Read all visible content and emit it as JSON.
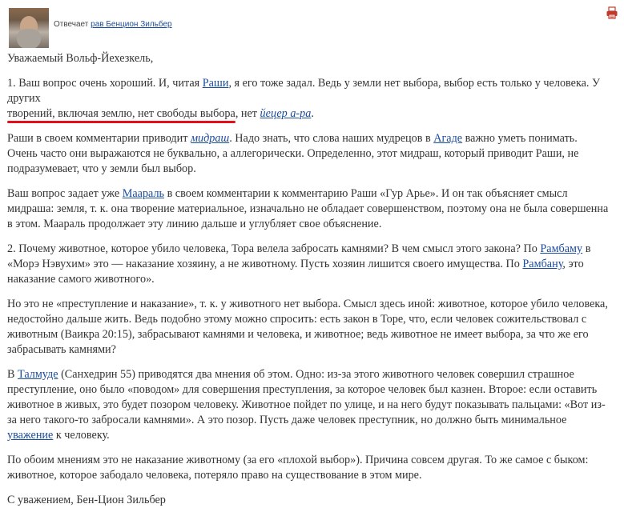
{
  "header": {
    "answered_by_prefix": "Отвечает",
    "author_name": "рав Бенцион Зильбер",
    "print_icon": "printer-icon"
  },
  "greeting": "Уважаемый Вольф-Йехезкель,",
  "p1": {
    "a": "1. Ваш вопрос очень хороший. И, читая ",
    "rashi": "Раши",
    "b": ", я его тоже задал. Ведь ",
    "hl1": "у земли нет выбора, выбор есть только у человека. У других",
    "hl2": "творений, включая землю, нет свободы выбора",
    "c": ", нет ",
    "yetzer": "йецер а-ра",
    "d": "."
  },
  "p2": {
    "a": "Раши в своем комментарии приводит ",
    "midrash": "мидраш",
    "b": ". Надо знать, что слова наших мудрецов в ",
    "agada": "Агаде",
    "c": " важно уметь понимать. Очень часто они выражаются не буквально, а аллегорически. Определенно, этот мидраш, который приводит Раши, не подразумевает, что у земли был выбор."
  },
  "p3": {
    "a": "Ваш вопрос задает уже ",
    "maharal": "Маараль",
    "b": " в своем комментарии к комментарию Раши «Гур Арье». И он так объясняет смысл мидраша: земля, т. к. она творение материальное, изначально не обладает совершенством, поэтому она не была совершенна в этом. Маараль продолжает эту линию дальше и углубляет свое объяснение."
  },
  "p4": {
    "a": "2. Почему животное, которое убило человека, Тора велела забросать камнями? В чем смысл этого закона? По ",
    "rambam": "Рамбаму",
    "b": " в «Морэ Нэвухим» это — наказание хозяину, а не животному. Пусть хозяин лишится своего имущества. По ",
    "ramban": "Рамбану",
    "c": ", это наказание самого животного»."
  },
  "p5": "Но это не «преступление и наказание», т. к. у животного нет выбора. Смысл здесь иной: животное, которое убило человека, недостойно дальше жить. Ведь подобно этому можно спросить: есть закон в Торе, что, если человек сожительствовал с животным (Ваикра 20:15), забрасывают камнями и человека, и животное; ведь животное не имеет выбора, за что же его забрасывать камнями?",
  "p6": {
    "a": "В ",
    "talmud": "Талмуде",
    "b": " (Санхедрин 55) приводятся два мнения об этом. Одно: из-за этого животного человек совершил страшное преступление, оно было «поводом» для совершения преступления, за которое человек был казнен. Второе: если оставить животное в живых, это будет позором человеку. Животное пойдет по улице, и на него будут показывать пальцами: «Вот из-за него такого-то забросали камнями». А это позор. Пусть даже человек преступник, но должно быть минимальное ",
    "respect": "уважение",
    "c": " к человеку."
  },
  "p7": "По обоим мнениям это не наказание животному (за его «плохой выбор»). Причина совсем другая. То же самое с быком: животное, которое забодало человека, потеряло право на существование в этом мире.",
  "signature": "С уважением, Бен-Цион Зильбер",
  "colors": {
    "link": "#1a4c9c",
    "highlight_underline": "#e3101b",
    "text": "#333333",
    "print_icon": "#c0392b"
  }
}
